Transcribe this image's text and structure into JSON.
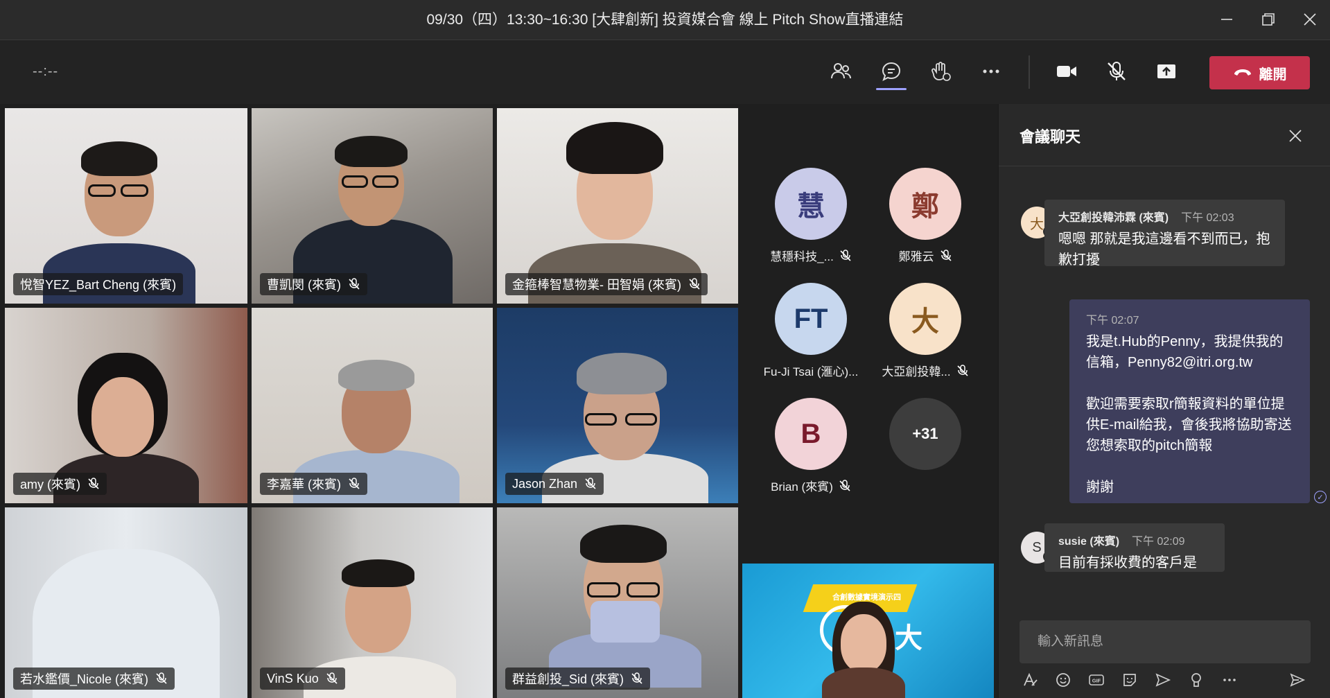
{
  "window": {
    "title": "09/30（四）13:30~16:30 [大肆創新] 投資媒合會 線上 Pitch Show直播連結"
  },
  "controls": {
    "timer": "--:--",
    "leave_label": "離開",
    "icons": [
      "people-icon",
      "chat-icon",
      "raise-hand-icon",
      "more-icon",
      "camera-icon",
      "mic-off-icon",
      "share-icon",
      "phone-icon"
    ]
  },
  "tiles": [
    {
      "name": "悅智YEZ_Bart Cheng (來賓)",
      "muted": false,
      "speaking": true
    },
    {
      "name": "曹凱閔 (來賓)",
      "muted": true
    },
    {
      "name": "金箍棒智慧物業- 田智娟 (來賓)",
      "muted": true
    },
    {
      "name": "amy (來賓)",
      "muted": true
    },
    {
      "name": "李嘉華 (來賓)",
      "muted": true
    },
    {
      "name": "Jason Zhan",
      "muted": true
    },
    {
      "name": "若水鑑價_Nicole (來賓)",
      "muted": true
    },
    {
      "name": "VinS Kuo",
      "muted": true
    },
    {
      "name": "群益創投_Sid (來賓)",
      "muted": true
    }
  ],
  "avatars": [
    {
      "initials": "慧",
      "label": "慧穩科技_...",
      "muted": true,
      "bg": "#c9cbe9",
      "fg": "#3a3d7c"
    },
    {
      "initials": "鄭",
      "label": "鄭雅云",
      "muted": true,
      "bg": "#f5d4cf",
      "fg": "#8b3b2f"
    },
    {
      "initials": "FT",
      "label": "Fu-Ji Tsai (滙心)...",
      "muted": false,
      "bg": "#c7d7ee",
      "fg": "#1d3a6b"
    },
    {
      "initials": "大",
      "label": "大亞創投韓...",
      "muted": true,
      "bg": "#f8e2c9",
      "fg": "#8a5a1f"
    },
    {
      "initials": "B",
      "label": "Brian (來賓)",
      "muted": true,
      "bg": "#f2d3d8",
      "fg": "#7a1a2c"
    },
    {
      "initials": "+31",
      "label": "",
      "muted": false,
      "bg": "#3d3d3d",
      "fg": "#ffffff"
    }
  ],
  "shared_slide": {
    "overlay_text": "大",
    "banner_text": "合創數據實境演示四"
  },
  "chat": {
    "title": "會議聊天",
    "messages": [
      {
        "sender": "大亞創投韓沛霖 (來賓)",
        "time": "下午 02:03",
        "text": "嗯嗯 那就是我這邊看不到而已，抱歉打擾",
        "avatar": "大"
      },
      {
        "sender": "",
        "time": "下午 02:07",
        "text": "我是t.Hub的Penny，我提供我的信箱，Penny82@itri.org.tw\n\n歡迎需要索取r簡報資料的單位提供E-mail給我，會後我將協助寄送您想索取的pitch簡報\n\n謝謝",
        "avatar": ""
      },
      {
        "sender": "susie (來賓)",
        "time": "下午 02:09",
        "text": "目前有採收費的客戶是",
        "avatar": "S"
      }
    ],
    "compose_placeholder": "輸入新訊息",
    "tool_icons": [
      "format-icon",
      "emoji-icon",
      "gif-icon",
      "sticker-icon",
      "send-later-icon",
      "praise-icon",
      "more-icon",
      "send-icon"
    ]
  },
  "colors": {
    "accent": "#9ea2ff",
    "leave": "#c4314b",
    "background": "#1f1f1f"
  }
}
